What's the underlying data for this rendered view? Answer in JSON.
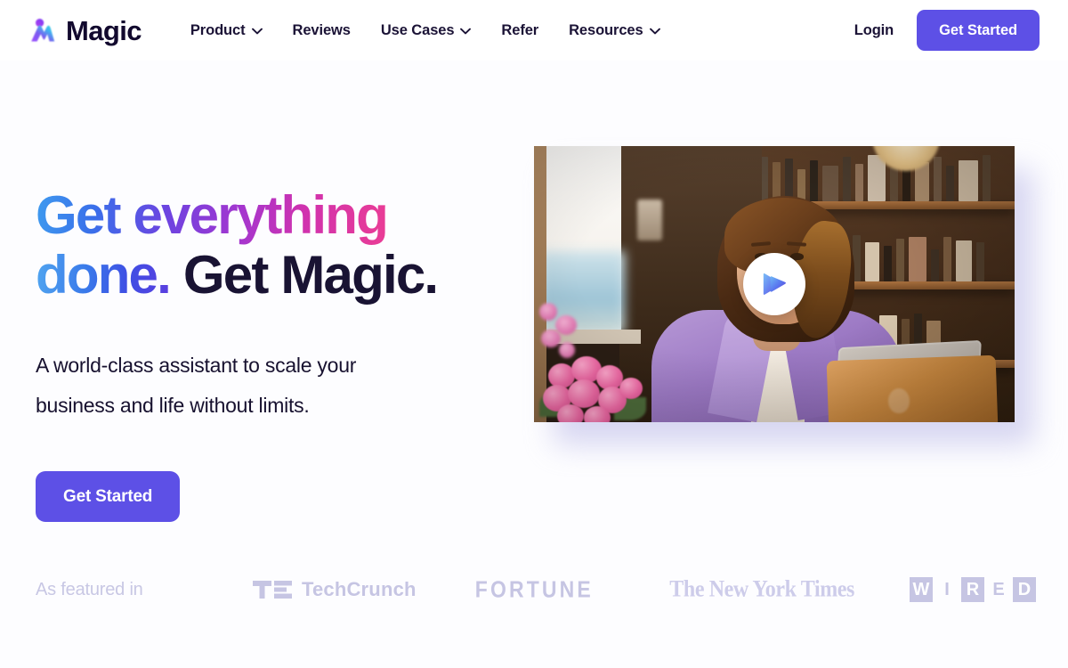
{
  "brand": {
    "name": "Magic",
    "logo_icon": "magic-m-logo"
  },
  "colors": {
    "accent_purple": "#5d50e6",
    "headline_dark": "#191333",
    "gradient_start": "#3f9bef",
    "gradient_end": "#ea3d95",
    "featured_gray": "#c6c5e3",
    "page_bg": "#fdfdff"
  },
  "header": {
    "nav": [
      {
        "label": "Product",
        "has_dropdown": true
      },
      {
        "label": "Reviews",
        "has_dropdown": false
      },
      {
        "label": "Use Cases",
        "has_dropdown": true
      },
      {
        "label": "Refer",
        "has_dropdown": false
      },
      {
        "label": "Resources",
        "has_dropdown": true
      }
    ],
    "login_label": "Login",
    "cta_label": "Get Started"
  },
  "hero": {
    "headline_line1": "Get everything",
    "headline_line2_gradient": "done.",
    "headline_line2_solid": "Get Magic.",
    "subhead_line1": "A world-class assistant to scale your",
    "subhead_line2": "business and life without limits.",
    "cta_label": "Get Started",
    "video": {
      "play_button_icon": "play-icon",
      "alt": "Smiling woman in purple shirt working on a laptop at a desk with pink flowers and a bookshelf behind her"
    }
  },
  "featured": {
    "label": "As featured in",
    "logos": [
      {
        "name": "techcrunch-logo",
        "word": "TechCrunch"
      },
      {
        "name": "fortune-logo",
        "word": "FORTUNE"
      },
      {
        "name": "new-york-times-logo",
        "word": "The New York Times"
      },
      {
        "name": "wired-logo",
        "letters": [
          "W",
          "I",
          "R",
          "E",
          "D"
        ]
      }
    ]
  }
}
